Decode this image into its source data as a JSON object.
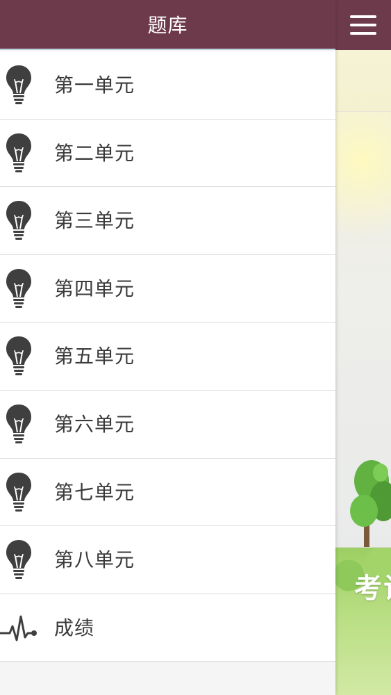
{
  "drawer": {
    "title": "题库",
    "items": [
      {
        "label": "第一单元",
        "icon": "lightbulb-icon"
      },
      {
        "label": "第二单元",
        "icon": "lightbulb-icon"
      },
      {
        "label": "第三单元",
        "icon": "lightbulb-icon"
      },
      {
        "label": "第四单元",
        "icon": "lightbulb-icon"
      },
      {
        "label": "第五单元",
        "icon": "lightbulb-icon"
      },
      {
        "label": "第六单元",
        "icon": "lightbulb-icon"
      },
      {
        "label": "第七单元",
        "icon": "lightbulb-icon"
      },
      {
        "label": "第八单元",
        "icon": "lightbulb-icon"
      },
      {
        "label": "成绩",
        "icon": "pulse-icon"
      }
    ]
  },
  "main": {
    "menu_icon": "hamburger-icon",
    "banner_caption": "考试"
  },
  "colors": {
    "header": "#6d3a4b",
    "icon": "#3f3f3f",
    "text": "#3a3a3a"
  }
}
